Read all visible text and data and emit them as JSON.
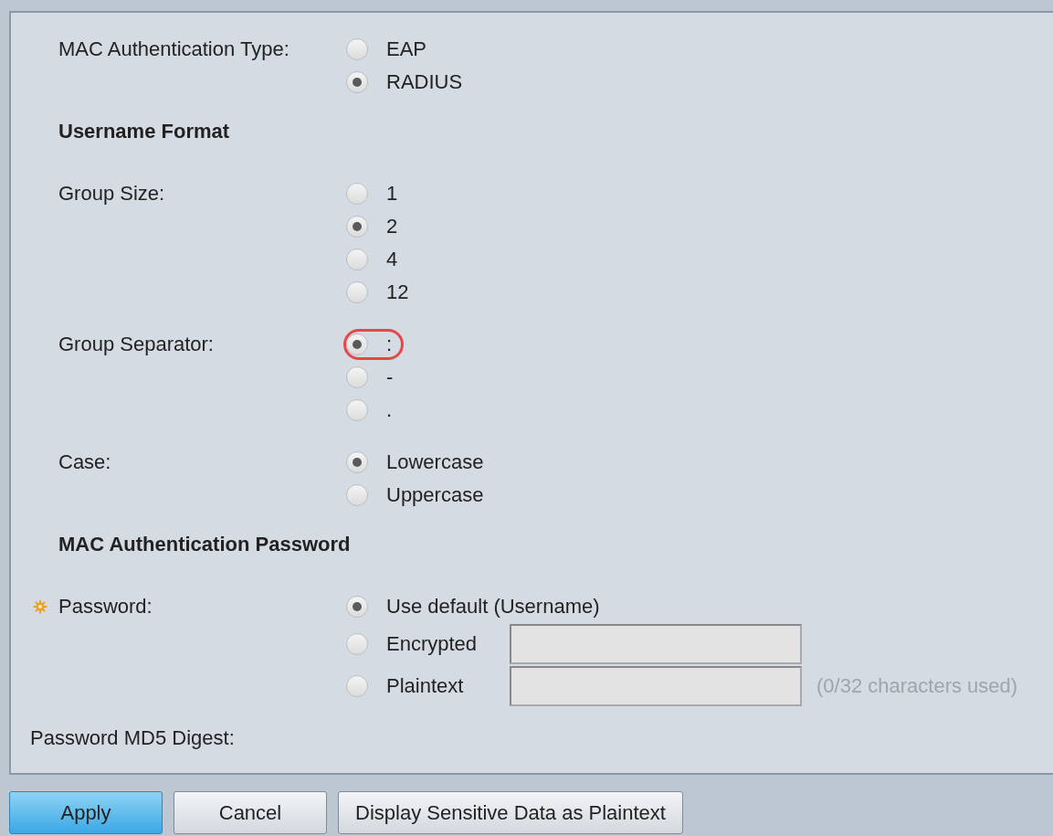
{
  "sections": [
    {
      "kind": "radio_group",
      "label": "MAC Authentication Type:",
      "options": [
        {
          "label": "EAP",
          "selected": false,
          "highlighted": false
        },
        {
          "label": "RADIUS",
          "selected": true,
          "highlighted": false
        }
      ]
    },
    {
      "kind": "heading",
      "text": "Username Format"
    },
    {
      "kind": "radio_group",
      "label": "Group Size:",
      "options": [
        {
          "label": "1",
          "selected": false,
          "highlighted": false
        },
        {
          "label": "2",
          "selected": true,
          "highlighted": false
        },
        {
          "label": "4",
          "selected": false,
          "highlighted": false
        },
        {
          "label": "12",
          "selected": false,
          "highlighted": false
        }
      ]
    },
    {
      "kind": "radio_group",
      "label": "Group Separator:",
      "options": [
        {
          "label": ":",
          "selected": true,
          "highlighted": true
        },
        {
          "label": "-",
          "selected": false,
          "highlighted": false
        },
        {
          "label": ".",
          "selected": false,
          "highlighted": false
        }
      ]
    },
    {
      "kind": "radio_group",
      "label": "Case:",
      "options": [
        {
          "label": "Lowercase",
          "selected": true,
          "highlighted": false
        },
        {
          "label": "Uppercase",
          "selected": false,
          "highlighted": false
        }
      ]
    },
    {
      "kind": "heading",
      "text": "MAC Authentication Password"
    },
    {
      "kind": "radio_group",
      "label": "Password:",
      "required": true,
      "options": [
        {
          "label": "Use default (Username)",
          "selected": true,
          "highlighted": false
        },
        {
          "label": "Encrypted",
          "selected": false,
          "highlighted": false,
          "kind": "field"
        },
        {
          "label": "Plaintext",
          "selected": false,
          "highlighted": false,
          "kind": "field",
          "hint": "(0/32 characters used)"
        }
      ]
    },
    {
      "kind": "outdented_label",
      "text": "Password MD5 Digest:"
    }
  ],
  "buttons": [
    {
      "label": "Apply",
      "kind": "primary"
    },
    {
      "label": "Cancel",
      "kind": "normal"
    },
    {
      "label": "Display Sensitive Data as Plaintext",
      "kind": "normal"
    }
  ]
}
